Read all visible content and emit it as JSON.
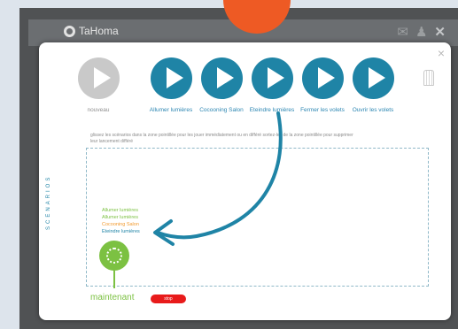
{
  "app": {
    "name": "TaHoma",
    "name_suffix": "°"
  },
  "toolbar": {
    "icons": [
      "mail-icon",
      "user-icon",
      "close-icon"
    ]
  },
  "dialog": {
    "close_label": "×",
    "tiles": [
      {
        "label": "nouveau",
        "enabled": false
      },
      {
        "label": "Allumer lumières",
        "enabled": true
      },
      {
        "label": "Cocooning Salon",
        "enabled": true
      },
      {
        "label": "Eteindre lumières",
        "enabled": true
      },
      {
        "label": "Fermer les volets",
        "enabled": true
      },
      {
        "label": "Ouvrir les volets",
        "enabled": true
      }
    ],
    "instructions": "glissez les scénarios dans la zone pointillée pour les jouer immédiatement ou en différé sortez-les de la zone pointillée pour supprimer leur lancement différé",
    "scenario_queue": [
      "Allumer lumières",
      "Allumer lumières",
      "Cocooning Salon",
      "Eteindre lumières"
    ],
    "side_label": "SCENARIOS",
    "now_label": "maintenant",
    "stop_label": "stop"
  },
  "colors": {
    "accent_blue": "#1f84a6",
    "accent_green": "#7cc142",
    "accent_orange": "#ee5a24",
    "stop_red": "#e81b1b"
  }
}
